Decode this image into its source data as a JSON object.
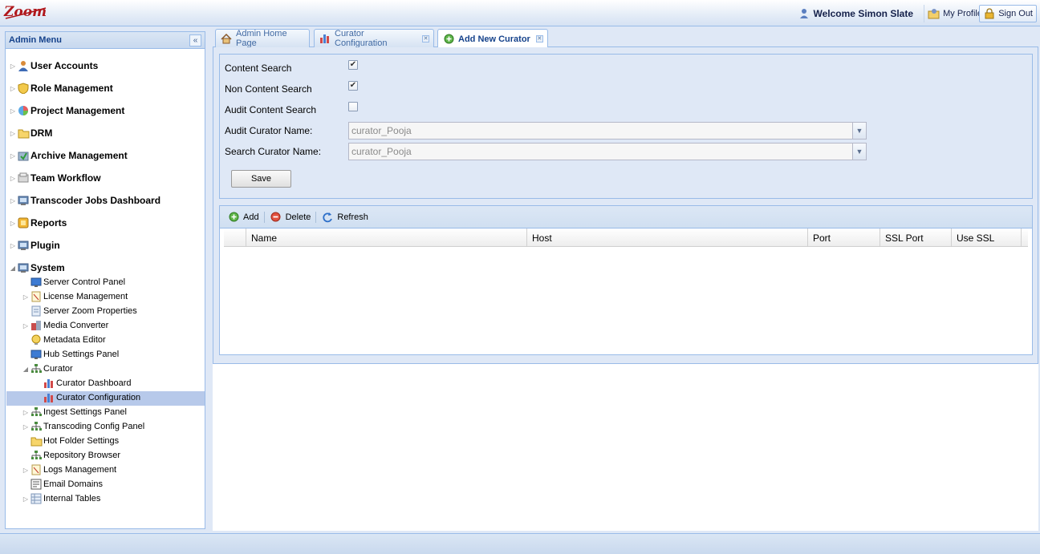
{
  "header": {
    "logo_text": "Zoom",
    "welcome": "Welcome Simon Slate",
    "my_profile": "My Profile",
    "sign_out": "Sign Out"
  },
  "sidebar": {
    "title": "Admin Menu",
    "items": [
      {
        "label": "User Accounts",
        "icon": "user-icon"
      },
      {
        "label": "Role Management",
        "icon": "shield-icon"
      },
      {
        "label": "Project Management",
        "icon": "pie-chart-icon"
      },
      {
        "label": "DRM",
        "icon": "folder-icon"
      },
      {
        "label": "Archive Management",
        "icon": "archive-icon"
      },
      {
        "label": "Team Workflow",
        "icon": "workflow-icon"
      },
      {
        "label": "Transcoder Jobs Dashboard",
        "icon": "server-icon"
      },
      {
        "label": "Reports",
        "icon": "reports-icon"
      },
      {
        "label": "Plugin",
        "icon": "plugin-icon"
      },
      {
        "label": "System",
        "icon": "system-icon"
      }
    ],
    "system_children": [
      {
        "label": "Server Control Panel",
        "icon": "monitor-icon"
      },
      {
        "label": "License Management",
        "icon": "license-icon"
      },
      {
        "label": "Server Zoom Properties",
        "icon": "properties-icon"
      },
      {
        "label": "Media Converter",
        "icon": "media-icon"
      },
      {
        "label": "Metadata Editor",
        "icon": "metadata-icon"
      },
      {
        "label": "Hub Settings Panel",
        "icon": "monitor-icon"
      },
      {
        "label": "Curator",
        "icon": "network-icon"
      },
      {
        "label": "Curator Dashboard",
        "icon": "bar-chart-icon"
      },
      {
        "label": "Curator Configuration",
        "icon": "bar-chart-icon"
      },
      {
        "label": "Ingest Settings Panel",
        "icon": "network-icon"
      },
      {
        "label": "Transcoding Config Panel",
        "icon": "network-icon"
      },
      {
        "label": "Hot Folder Settings",
        "icon": "folder-icon"
      },
      {
        "label": "Repository Browser",
        "icon": "network-icon"
      },
      {
        "label": "Logs Management",
        "icon": "license-icon"
      },
      {
        "label": "Email Domains",
        "icon": "list-icon"
      },
      {
        "label": "Internal Tables",
        "icon": "table-icon"
      }
    ]
  },
  "tabs": [
    {
      "label": "Admin Home Page",
      "icon": "home-icon"
    },
    {
      "label": "Curator Configuration",
      "icon": "bar-chart-icon"
    },
    {
      "label": "Add New Curator",
      "icon": "add-icon"
    }
  ],
  "form": {
    "content_search_label": "Content Search",
    "content_search_checked": true,
    "non_content_search_label": "Non Content Search",
    "non_content_search_checked": true,
    "audit_content_search_label": "Audit Content Search",
    "audit_content_search_checked": false,
    "audit_curator_label": "Audit Curator Name:",
    "audit_curator_value": "curator_Pooja",
    "search_curator_label": "Search Curator Name:",
    "search_curator_value": "curator_Pooja",
    "save_label": "Save"
  },
  "grid": {
    "toolbar": {
      "add": "Add",
      "delete": "Delete",
      "refresh": "Refresh"
    },
    "columns": [
      "Name",
      "Host",
      "Port",
      "SSL Port",
      "Use SSL"
    ],
    "rows": []
  },
  "colors": {
    "panel_border": "#99bbe8",
    "panel_bg": "#dfe8f6",
    "title_blue": "#15428b",
    "selection": "#b7c9ea"
  }
}
